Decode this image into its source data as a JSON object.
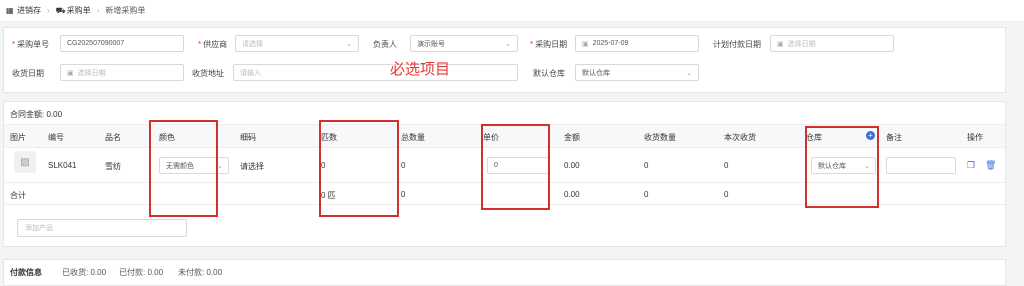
{
  "breadcrumb": {
    "items": [
      "进销存",
      "采购单",
      "新增采购单"
    ]
  },
  "form": {
    "order_no": {
      "label": "采购单号",
      "value": "CG202507090007"
    },
    "supplier": {
      "label": "供应商",
      "placeholder": "请选择"
    },
    "owner": {
      "label": "负责人",
      "value": "演示账号"
    },
    "purchase_date": {
      "label": "采购日期",
      "value": "2025-07-09"
    },
    "planned_pay_date": {
      "label": "计划付款日期",
      "placeholder": "选择日期"
    },
    "receive_date": {
      "label": "收货日期",
      "placeholder": "选择日期"
    },
    "receive_address": {
      "label": "收货地址",
      "placeholder": "请输入"
    },
    "default_warehouse": {
      "label": "默认仓库",
      "value": "默认仓库"
    }
  },
  "annotation": "必选项目",
  "table": {
    "contract_amount_label": "合同金额:",
    "contract_amount_value": "0.00",
    "headers": {
      "image": "图片",
      "code": "编号",
      "name": "品名",
      "color": "颜色",
      "yard": "细码",
      "pieces": "匹数",
      "total_qty": "总数量",
      "unit_price": "单价",
      "amount": "金额",
      "received_qty": "收货数量",
      "this_receive": "本次收货",
      "warehouse": "仓库",
      "remark": "备注",
      "action": "操作"
    },
    "row": {
      "code": "SLK041",
      "name": "雪纺",
      "color": "无需颜色",
      "yard": "请选择",
      "pieces": "0",
      "total_qty": "0",
      "unit_price": "0",
      "amount": "0.00",
      "received_qty": "0",
      "this_receive": "0",
      "warehouse": "默认仓库"
    },
    "total": {
      "label": "合计",
      "pieces": "0 匹",
      "total_qty": "0",
      "amount": "0.00",
      "received_qty": "0",
      "this_receive": "0"
    },
    "add_product_placeholder": "添加产品"
  },
  "payment": {
    "title": "付款信息",
    "received_label": "已收货:",
    "received_value": "0.00",
    "paid_label": "已付款:",
    "paid_value": "0.00",
    "unpaid_label": "未付款:",
    "unpaid_value": "0.00"
  },
  "colors": {
    "highlight": "#d32f2f",
    "accent": "#3b6fd8"
  }
}
